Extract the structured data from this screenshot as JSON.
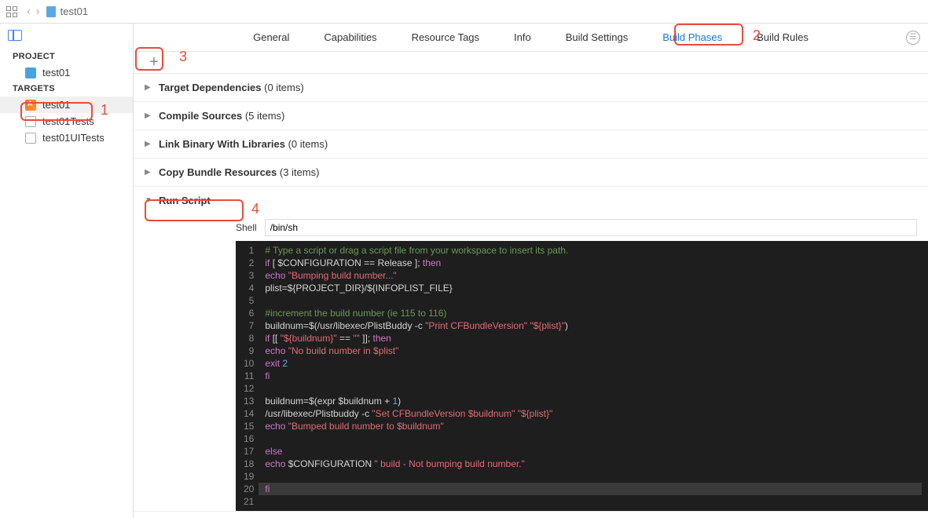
{
  "breadcrumb": "test01",
  "sidebar": {
    "project_head": "PROJECT",
    "targets_head": "TARGETS",
    "project_item": "test01",
    "targets": [
      {
        "label": "test01",
        "selected": true,
        "icon": "orange"
      },
      {
        "label": "test01Tests",
        "selected": false,
        "icon": "gray"
      },
      {
        "label": "test01UITests",
        "selected": false,
        "icon": "gray"
      }
    ]
  },
  "tabs": [
    "General",
    "Capabilities",
    "Resource Tags",
    "Info",
    "Build Settings",
    "Build Phases",
    "Build Rules"
  ],
  "active_tab": "Build Phases",
  "phases": [
    {
      "name": "Target Dependencies",
      "count": "(0 items)"
    },
    {
      "name": "Compile Sources",
      "count": "(5 items)"
    },
    {
      "name": "Link Binary With Libraries",
      "count": "(0 items)"
    },
    {
      "name": "Copy Bundle Resources",
      "count": "(3 items)"
    }
  ],
  "run_script_label": "Run Script",
  "shell_label": "Shell",
  "shell_value": "/bin/sh",
  "code_lines": [
    [
      {
        "c": "c-comment",
        "t": "# Type a script or drag a script file from your workspace to insert its path."
      }
    ],
    [
      {
        "c": "c-kw",
        "t": "if"
      },
      {
        "c": "c-var",
        "t": " [ $CONFIGURATION == Release ]; "
      },
      {
        "c": "c-kw",
        "t": "then"
      }
    ],
    [
      {
        "c": "c-kw",
        "t": "echo"
      },
      {
        "c": "c-var",
        "t": " "
      },
      {
        "c": "c-str",
        "t": "\"Bumping build number...\""
      }
    ],
    [
      {
        "c": "c-var",
        "t": "plist=${PROJECT_DIR}/${INFOPLIST_FILE}"
      }
    ],
    [],
    [
      {
        "c": "c-comment",
        "t": "#increment the build number (ie 115 to 116)"
      }
    ],
    [
      {
        "c": "c-var",
        "t": "buildnum=$(/usr/libexec/PlistBuddy -c "
      },
      {
        "c": "c-str",
        "t": "\"Print CFBundleVersion\" \"${plist}\""
      },
      {
        "c": "c-var",
        "t": ")"
      }
    ],
    [
      {
        "c": "c-kw",
        "t": "if"
      },
      {
        "c": "c-var",
        "t": " [[ "
      },
      {
        "c": "c-str",
        "t": "\"${buildnum}\""
      },
      {
        "c": "c-var",
        "t": " == "
      },
      {
        "c": "c-str",
        "t": "\"\""
      },
      {
        "c": "c-var",
        "t": " ]]; "
      },
      {
        "c": "c-kw",
        "t": "then"
      }
    ],
    [
      {
        "c": "c-kw",
        "t": "echo"
      },
      {
        "c": "c-var",
        "t": " "
      },
      {
        "c": "c-str",
        "t": "\"No build number in $plist\""
      }
    ],
    [
      {
        "c": "c-kw",
        "t": "exit"
      },
      {
        "c": "c-var",
        "t": " "
      },
      {
        "c": "c-num",
        "t": "2"
      }
    ],
    [
      {
        "c": "c-kw",
        "t": "fi"
      }
    ],
    [],
    [
      {
        "c": "c-var",
        "t": "buildnum=$(expr $buildnum + "
      },
      {
        "c": "c-num",
        "t": "1"
      },
      {
        "c": "c-var",
        "t": ")"
      }
    ],
    [
      {
        "c": "c-var",
        "t": "/usr/libexec/Plistbuddy -c "
      },
      {
        "c": "c-str",
        "t": "\"Set CFBundleVersion $buildnum\" \"${plist}\""
      }
    ],
    [
      {
        "c": "c-kw",
        "t": "echo"
      },
      {
        "c": "c-var",
        "t": " "
      },
      {
        "c": "c-str",
        "t": "\"Bumped build number to $buildnum\""
      }
    ],
    [],
    [
      {
        "c": "c-kw",
        "t": "else"
      }
    ],
    [
      {
        "c": "c-kw",
        "t": "echo"
      },
      {
        "c": "c-var",
        "t": " $CONFIGURATION "
      },
      {
        "c": "c-str",
        "t": "\" build - Not bumping build number.\""
      }
    ],
    [],
    [
      {
        "c": "c-kw",
        "t": "fi"
      }
    ],
    []
  ],
  "annotations": {
    "1": "1",
    "2": "2",
    "3": "3",
    "4": "4"
  }
}
